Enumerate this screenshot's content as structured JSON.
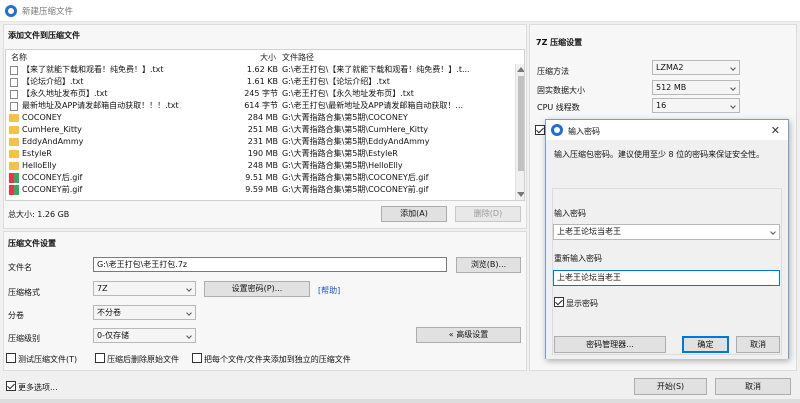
{
  "window": {
    "title": "新建压缩文件"
  },
  "files": {
    "section_title": "添加文件到压缩文件",
    "col_name": "名称",
    "col_size": "大小",
    "col_path": "文件路径",
    "rows": [
      {
        "icon": "file-icon",
        "name": "【来了就能下载和观看！纯免费！】.txt",
        "size": "1.62 KB",
        "path": "G:\\老王打包\\【来了就能下载和观看！纯免费！】.t..."
      },
      {
        "icon": "file-icon",
        "name": "【论坛介绍】.txt",
        "size": "1.61 KB",
        "path": "G:\\老王打包\\【论坛介绍】.txt"
      },
      {
        "icon": "file-icon",
        "name": "【永久地址发布页】.txt",
        "size": "245 字节",
        "path": "G:\\老王打包\\【永久地址发布页】.txt"
      },
      {
        "icon": "file-icon",
        "name": "最新地址及APP请发邮箱自动获取！！！.txt",
        "size": "614 字节",
        "path": "G:\\老王打包\\最新地址及APP请发邮箱自动获取！..."
      },
      {
        "icon": "folder-icon",
        "name": "COCONEY",
        "size": "284 MB",
        "path": "G:\\大菁指路合集\\第5期\\COCONEY"
      },
      {
        "icon": "folder-icon",
        "name": "CumHere_Kitty",
        "size": "251 MB",
        "path": "G:\\大菁指路合集\\第5期\\CumHere_Kitty"
      },
      {
        "icon": "folder-icon",
        "name": "EddyAndAmmy",
        "size": "231 MB",
        "path": "G:\\大菁指路合集\\第5期\\EddyAndAmmy"
      },
      {
        "icon": "folder-icon",
        "name": "EstyleR",
        "size": "190 MB",
        "path": "G:\\大菁指路合集\\第5期\\EstyleR"
      },
      {
        "icon": "folder-icon",
        "name": "HelloElly",
        "size": "248 MB",
        "path": "G:\\大菁指路合集\\第5期\\HelloElly"
      },
      {
        "icon": "gif-icon",
        "name": "COCONEY后.gif",
        "size": "9.51 MB",
        "path": "G:\\大菁指路合集\\第5期\\COCONEY后.gif"
      },
      {
        "icon": "gif-icon",
        "name": "COCONEY前.gif",
        "size": "9.59 MB",
        "path": "G:\\大菁指路合集\\第5期\\COCONEY前.gif"
      }
    ],
    "total_size": "总大小: 1.26 GB",
    "add_button": "添加(A)",
    "delete_button": "删除(D)"
  },
  "settings": {
    "section_title": "压缩文件设置",
    "filename_label": "文件名",
    "filename_value": "G:\\老王打包\\老王打包.7z",
    "browse_button": "浏览(B)...",
    "format_label": "压缩格式",
    "format_value": "7Z",
    "password_button": "设置密码(P)...",
    "help_link": "[帮助]",
    "split_label": "分卷",
    "split_value": "不分卷",
    "level_label": "压缩级别",
    "level_value": "0-仅存储",
    "advanced_button": "« 高级设置",
    "test_archive": "测试压缩文件(T)",
    "delete_after": "压缩后删除原始文件",
    "separate_archive": "把每个文件/文件夹添加到独立的压缩文件"
  },
  "seven_zip": {
    "section_title": "7Z 压缩设置",
    "method_label": "压缩方法",
    "method_value": "LZMA2",
    "dict_label": "固实数据大小",
    "dict_value": "512 MB",
    "cpu_label": "CPU 线程数",
    "cpu_value": "16"
  },
  "footer": {
    "more_options": "更多选项...",
    "start_button": "开始(S)",
    "cancel_button": "取消"
  },
  "password_dialog": {
    "title": "输入密码",
    "hint": "输入压缩包密码。建议使用至少 8 位的密码来保证安全性。",
    "enter_label": "输入密码",
    "enter_value": "上老王论坛当老王",
    "reenter_label": "重新输入密码",
    "reenter_value": "上老王论坛当老王",
    "show_password": "显示密码",
    "manager_button": "密码管理器...",
    "ok_button": "确定",
    "cancel_button": "取消"
  }
}
